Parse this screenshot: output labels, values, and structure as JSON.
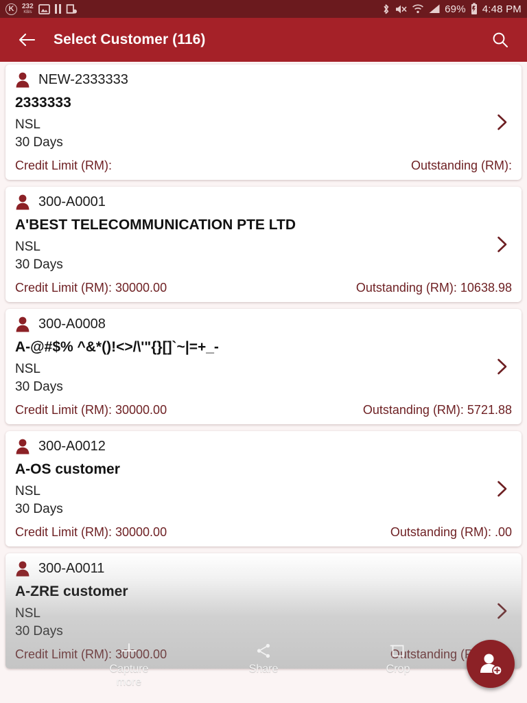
{
  "colors": {
    "status_bar_bg": "#6b1a1e",
    "app_bar_bg": "#a52128",
    "accent_maroon": "#6d1f22",
    "fab_bg": "#8c2126",
    "page_bg": "#fbf4f4"
  },
  "status_bar": {
    "app_badge": "K",
    "net_speed_value": "232",
    "net_speed_unit": "KB/s",
    "icons_left": [
      "app-badge-icon",
      "gallery-icon",
      "pause-icon",
      "screenshot-icon"
    ],
    "icons_right": [
      "bluetooth-icon",
      "mute-icon",
      "wifi-icon",
      "signal-icon",
      "battery-icon"
    ],
    "battery_percent": "69%",
    "clock": "4:48 PM"
  },
  "app_bar": {
    "back_icon": "arrow-back-icon",
    "title": "Select Customer (116)",
    "search_icon": "search-icon"
  },
  "list": {
    "credit_label": "Credit Limit (RM):",
    "outstanding_label": "Outstanding (RM):",
    "items": [
      {
        "code": "NEW-2333333",
        "name": "2333333",
        "account_type": "NSL",
        "terms": "30 Days",
        "credit_limit": "Credit Limit (RM):",
        "outstanding": "Outstanding (RM):"
      },
      {
        "code": "300-A0001",
        "name": "A'BEST TELECOMMUNICATION PTE LTD",
        "account_type": "NSL",
        "terms": "30 Days",
        "credit_limit": "Credit Limit (RM): 30000.00",
        "outstanding": "Outstanding (RM): 10638.98"
      },
      {
        "code": "300-A0008",
        "name": "A-@#$% ^&*()!<>/\\'\"{}[]`~|=+_-",
        "account_type": "NSL",
        "terms": "30 Days",
        "credit_limit": "Credit Limit (RM): 30000.00",
        "outstanding": "Outstanding (RM): 5721.88"
      },
      {
        "code": "300-A0012",
        "name": "A-OS customer",
        "account_type": "NSL",
        "terms": "30 Days",
        "credit_limit": "Credit Limit (RM): 30000.00",
        "outstanding": "Outstanding (RM): .00"
      },
      {
        "code": "300-A0011",
        "name": "A-ZRE customer",
        "account_type": "NSL",
        "terms": "30 Days",
        "credit_limit": "Credit Limit (RM): 30000.00",
        "outstanding": "Outstanding (RM): .00"
      }
    ]
  },
  "screenshot_toolbar": {
    "items": [
      {
        "label": "Capture\nmore",
        "label_line1": "Capture",
        "label_line2": "more",
        "icon": "plus-icon"
      },
      {
        "label": "Share",
        "label_line1": "Share",
        "label_line2": "",
        "icon": "share-icon"
      },
      {
        "label": "Crop",
        "label_line1": "Crop",
        "label_line2": "",
        "icon": "crop-icon"
      }
    ]
  },
  "fab": {
    "icon": "add-person-icon",
    "label": "Add customer"
  }
}
